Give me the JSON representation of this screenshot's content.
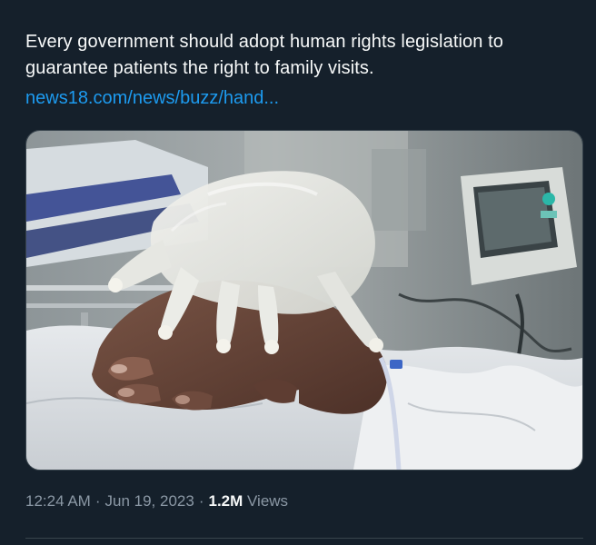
{
  "tweet": {
    "text": "Every government should adopt human rights legislation to guarantee patients the right to family visits.",
    "link": "news18.com/news/buzz/hand...",
    "media": {
      "icon": "photo-glove-hand-hospital"
    },
    "meta": {
      "time": "12:24 AM",
      "separator": "·",
      "date": "Jun 19, 2023",
      "views_count": "1.2M",
      "views_label": "Views"
    }
  },
  "colors": {
    "background": "#15202b",
    "text": "#f7f9f9",
    "link": "#1d9bf0",
    "secondary": "#8b98a5",
    "border": "#38444d"
  }
}
